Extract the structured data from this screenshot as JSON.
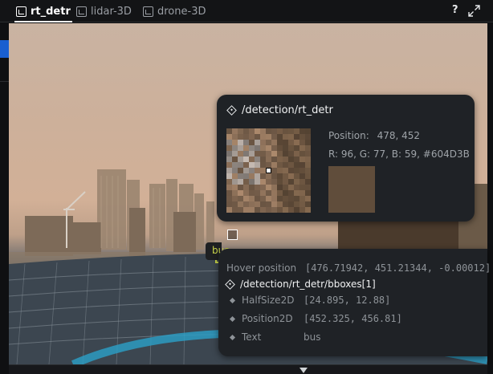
{
  "tabs": [
    {
      "label": "rt_detr",
      "active": true,
      "icon": "image-view-icon"
    },
    {
      "label": "lidar-3D",
      "active": false,
      "icon": "image-view-icon"
    },
    {
      "label": "drone-3D",
      "active": false,
      "icon": "image-view-icon"
    }
  ],
  "toolbar": {
    "help_label": "?",
    "expand_icon": "expand-icon"
  },
  "detection_label": "bus",
  "pixel_tooltip": {
    "entity_path": "/detection/rt_detr",
    "position_label": "Position:",
    "position_value": "478, 452",
    "rgb_text": "R: 96, G: 77, B: 59, #604D3B",
    "swatch_color": "#604D3B"
  },
  "hover_tooltip": {
    "hover_label": "Hover position",
    "hover_value": "[476.71942, 451.21344, -0.00012]",
    "entity_path": "/detection/rt_detr/bboxes[1]",
    "fields": [
      {
        "label": "HalfSize2D",
        "value": "[24.895, 12.88]"
      },
      {
        "label": "Position2D",
        "value": "[452.325, 456.81]"
      },
      {
        "label": "Text",
        "value": "bus"
      }
    ]
  },
  "colors": {
    "accent": "#1a5fd0",
    "bbox": "#c8d44a"
  }
}
